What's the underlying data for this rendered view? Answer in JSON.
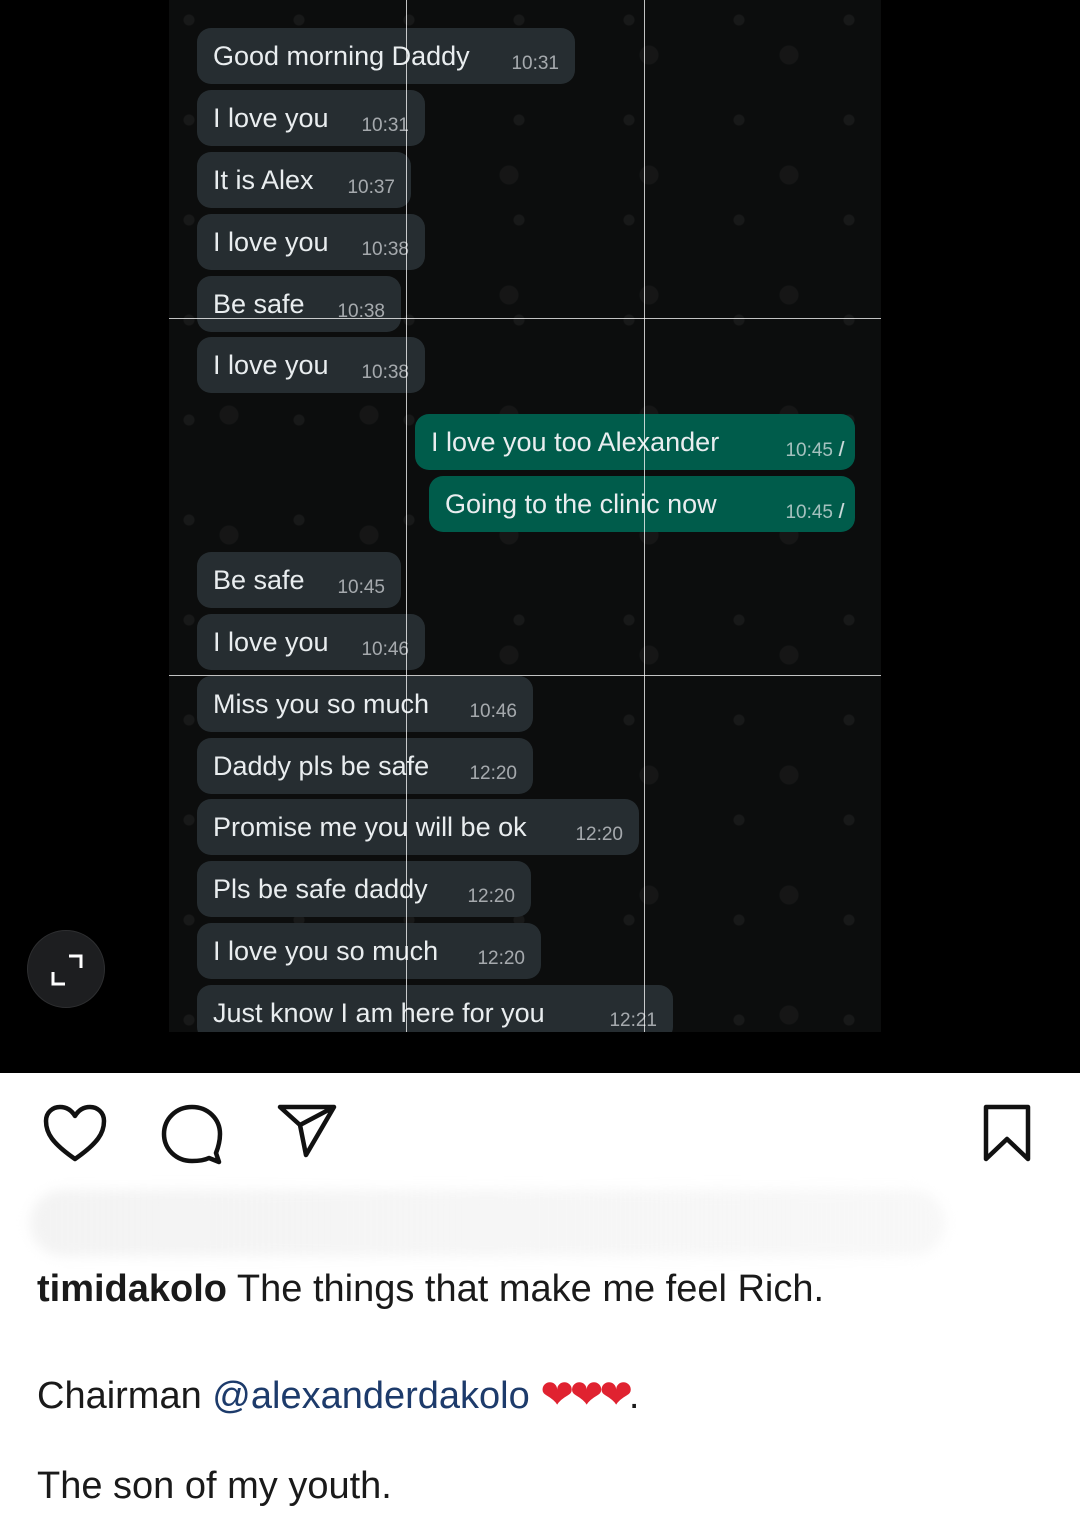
{
  "chat": {
    "messages": [
      {
        "dir": "in",
        "text": "Good morning Daddy",
        "time": "10:31"
      },
      {
        "dir": "in",
        "text": "I love you",
        "time": "10:31"
      },
      {
        "dir": "in",
        "text": "It is Alex",
        "time": "10:37"
      },
      {
        "dir": "in",
        "text": "I love you",
        "time": "10:38"
      },
      {
        "dir": "in",
        "text": "Be safe",
        "time": "10:38"
      },
      {
        "dir": "in",
        "text": "I love you",
        "time": "10:38"
      },
      {
        "dir": "out",
        "text": "I love you too Alexander",
        "time": "10:45"
      },
      {
        "dir": "out",
        "text": "Going to the clinic now",
        "time": "10:45"
      },
      {
        "dir": "in",
        "text": "Be safe",
        "time": "10:45"
      },
      {
        "dir": "in",
        "text": "I love you",
        "time": "10:46"
      },
      {
        "dir": "in",
        "text": "Miss you so much",
        "time": "10:46"
      },
      {
        "dir": "in",
        "text": "Daddy pls be safe",
        "time": "12:20"
      },
      {
        "dir": "in",
        "text": "Promise me you will be ok",
        "time": "12:20"
      },
      {
        "dir": "in",
        "text": "Pls be safe daddy",
        "time": "12:20"
      },
      {
        "dir": "in",
        "text": "I love you so much",
        "time": "12:20"
      },
      {
        "dir": "in",
        "text": "Just know I am here for you",
        "time": "12:21"
      }
    ],
    "colors": {
      "incoming_bubble": "#262d31",
      "outgoing_bubble": "#005c4b",
      "background": "#0c0d0d"
    }
  },
  "actions": {
    "icons": [
      "heart-icon",
      "comment-icon",
      "share-icon",
      "bookmark-icon"
    ]
  },
  "caption": {
    "username": "timidakolo",
    "line1": "The things that make me feel Rich.",
    "line2_prefix": "Chairman",
    "mention": "@alexanderdakolo",
    "hearts": "❤❤❤",
    "line2_suffix": ".",
    "line3": "The son of  my youth."
  }
}
